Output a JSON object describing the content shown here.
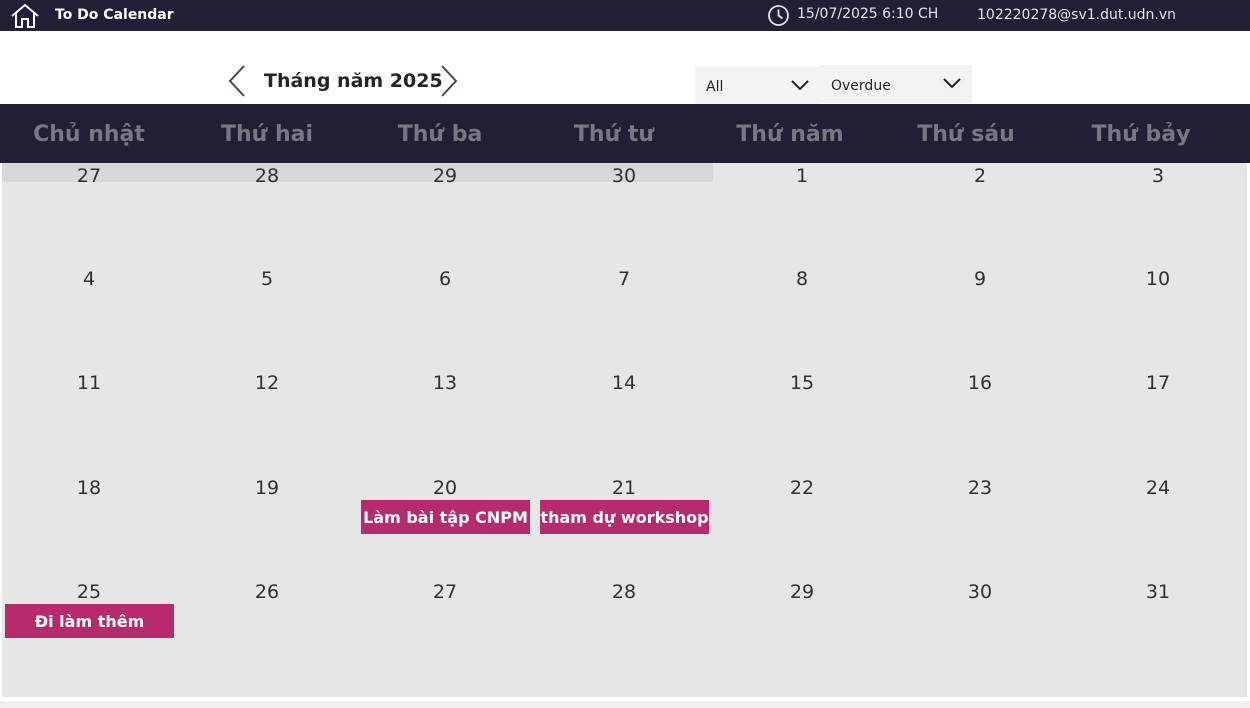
{
  "header": {
    "app_title": "To Do Calendar",
    "datetime": "15/07/2025 6:10 CH",
    "user_email": "102220278@sv1.dut.udn.vn",
    "icons": [
      "home-icon",
      "clock-icon"
    ]
  },
  "navigation": {
    "month_label": "Tháng năm 2025",
    "prev_icon": "chevron-left-icon",
    "next_icon": "chevron-right-icon"
  },
  "filters": {
    "category": "All",
    "status": "Overdue"
  },
  "weekdays": [
    "Chủ nhật",
    "Thứ hai",
    "Thứ ba",
    "Thứ tư",
    "Thứ năm",
    "Thứ sáu",
    "Thứ bảy"
  ],
  "weeks": [
    [
      "27",
      "28",
      "29",
      "30",
      "1",
      "2",
      "3"
    ],
    [
      "4",
      "5",
      "6",
      "7",
      "8",
      "9",
      "10"
    ],
    [
      "11",
      "12",
      "13",
      "14",
      "15",
      "16",
      "17"
    ],
    [
      "18",
      "19",
      "20",
      "21",
      "22",
      "23",
      "24"
    ],
    [
      "25",
      "26",
      "27",
      "28",
      "29",
      "30",
      "31"
    ]
  ],
  "events": [
    {
      "title": "Làm bài tập CNPM",
      "date": "20"
    },
    {
      "title": "tham dự workshop",
      "date": "21"
    },
    {
      "title": "Đi làm thêm",
      "date": "25"
    }
  ],
  "colors": {
    "header_bg": "#1f1f35",
    "grid_bg": "#e6e6e6",
    "prev_month_bg": "#d8d8d8",
    "event_bg": "#b72a6e"
  }
}
